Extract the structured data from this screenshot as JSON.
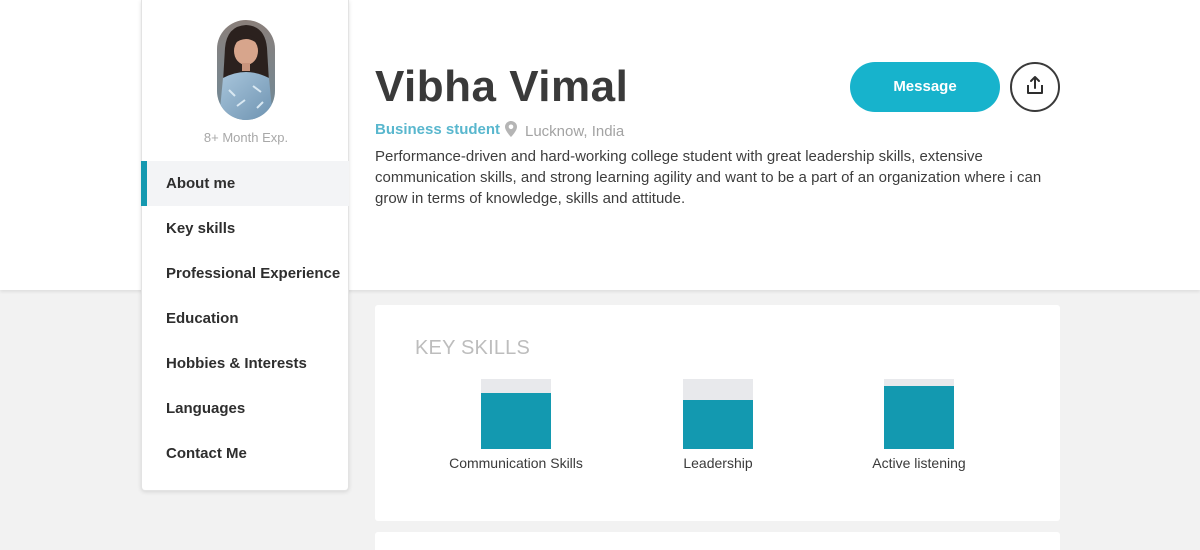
{
  "profile": {
    "name": "Vibha Vimal",
    "role": "Business student",
    "location": "Lucknow, India",
    "experience": "8+ Month Exp.",
    "bio": "Performance-driven and hard-working college student with great leadership skills, extensive communication skills, and strong learning agility and want to be a part of an organization where i can grow in terms of knowledge, skills and attitude."
  },
  "actions": {
    "message_label": "Message",
    "share_icon": "share-upload-icon"
  },
  "sidebar": {
    "items": [
      {
        "label": "About me",
        "active": true
      },
      {
        "label": "Key skills",
        "active": false
      },
      {
        "label": "Professional Experience",
        "active": false
      },
      {
        "label": "Education",
        "active": false
      },
      {
        "label": "Hobbies & Interests",
        "active": false
      },
      {
        "label": "Languages",
        "active": false
      },
      {
        "label": "Contact Me",
        "active": false
      }
    ]
  },
  "key_skills": {
    "title": "KEY SKILLS",
    "skills": [
      {
        "label": "Communication Skills",
        "level": 0.8
      },
      {
        "label": "Leadership",
        "level": 0.7
      },
      {
        "label": "Active listening",
        "level": 0.9
      }
    ]
  },
  "colors": {
    "accent": "#17b3cc",
    "bar": "#1399b0",
    "role": "#59b7ce"
  }
}
